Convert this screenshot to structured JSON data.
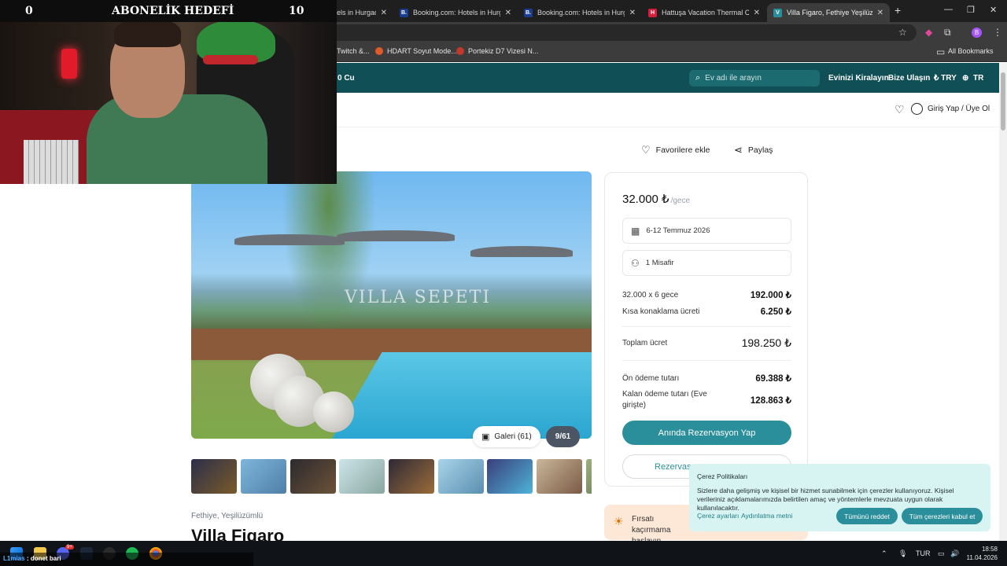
{
  "browser": {
    "tabs": [
      {
        "label": "els in Hurgad",
        "favicon_color": "#1f1f1f",
        "favicon_text": ""
      },
      {
        "label": "Booking.com: Hotels in Hurgad",
        "favicon_color": "#1a3d8f",
        "favicon_text": "B."
      },
      {
        "label": "Booking.com: Hotels in Hurgad",
        "favicon_color": "#1a3d8f",
        "favicon_text": "B."
      },
      {
        "label": "Hattuşa Vacation Thermal Club",
        "favicon_color": "#d21f3c",
        "favicon_text": "H"
      },
      {
        "label": "Villa Figaro, Fethiye Yeşilüzüml",
        "favicon_color": "#2a8f9a",
        "favicon_text": "V"
      }
    ],
    "profile_initial": "B",
    "bookmarks": [
      {
        "label": "Twitch &...",
        "color": "#9146ff"
      },
      {
        "label": "HDART Soyut Mode...",
        "color": "#e05a2a"
      },
      {
        "label": "Portekiz D7 Vizesi N...",
        "color": "#c0392b"
      }
    ],
    "all_bookmarks": "All Bookmarks"
  },
  "site": {
    "brand_fragment": "0 Cu",
    "search_placeholder": "Ev adı ile arayın",
    "nav": {
      "rent_home": "Evinizi Kiralayın",
      "contact": "Bize Ulaşın",
      "currency": "₺ TRY",
      "language": "TR"
    },
    "login": "Giriş Yap / Üye Ol",
    "favorite": "Favorilere ekle",
    "share": "Paylaş"
  },
  "gallery": {
    "watermark": "VILLA SEPETI",
    "gallery_label": "Galeri (61)",
    "counter": "9/61",
    "thumb_colors": [
      "#7a5a2a",
      "#4f7fa6",
      "#6b5236",
      "#8aa7a0",
      "#9b6b3a",
      "#5b8fb0",
      "#3a3e7a",
      "#7b5a45",
      "#5a6a4a"
    ]
  },
  "listing": {
    "location": "Fethiye, Yeşilüzümlü",
    "title": "Villa Figaro"
  },
  "booking": {
    "price": "32.000 ₺",
    "per_night": "/gece",
    "dates": "6-12 Temmuz 2026",
    "guests": "1 Misafir",
    "lines": [
      {
        "label": "32.000 x 6 gece",
        "value": "192.000 ₺"
      },
      {
        "label": "Kısa konaklama ücreti",
        "value": "6.250 ₺"
      }
    ],
    "total_label": "Toplam ücret",
    "total_value": "198.250 ₺",
    "prepay_label": "Ön ödeme tutarı",
    "prepay_value": "69.388 ₺",
    "remaining_label": "Kalan ödeme tutarı (Eve girişte)",
    "remaining_value": "128.863 ₺",
    "instant_button": "Anında Rezervasyon Yap",
    "request_button": "Rezervas"
  },
  "promo": {
    "text": "Fırsatı kaçırmama başlayın."
  },
  "cookie": {
    "title": "Çerez Politikaları",
    "body": "Sizlere daha gelişmiş ve kişisel bir hizmet sunabilmek için çerezler kullanıyoruz. Kişisel verileriniz açıklamalarımızda belirtilen amaç ve yöntemlerle mevzuata uygun olarak kullanılacaktır.",
    "settings_link": "Çerez ayarları",
    "clarification_link": "Aydınlatma metni",
    "reject_button": "Tümünü reddet",
    "accept_button": "Tüm çerezleri kabul et"
  },
  "stream": {
    "left_count": "0",
    "goal_title": "ABONELİK HEDEFİ",
    "right_count": "10",
    "chat_user": "L1mias",
    "chat_message": ": donet bari"
  },
  "taskbar": {
    "language": "TUR",
    "time": "18:58",
    "date": "11.04.2026",
    "discord_badge": "9+"
  }
}
